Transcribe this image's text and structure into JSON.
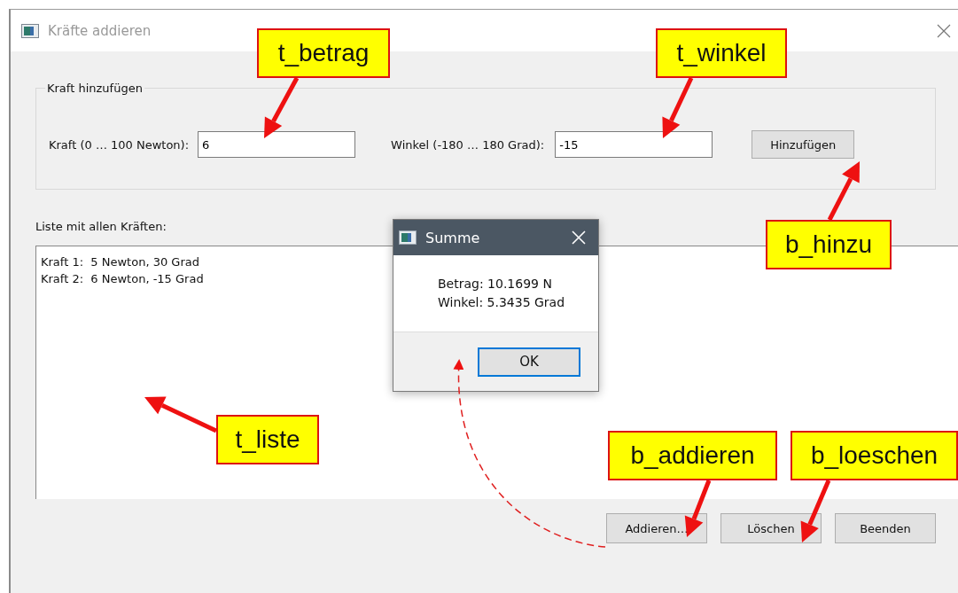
{
  "window": {
    "title": "Kräfte addieren"
  },
  "group": {
    "title": "Kraft hinzufügen",
    "force_label": "Kraft (0 … 100 Newton):",
    "force_value": "6",
    "angle_label": "Winkel (-180 … 180 Grad):",
    "angle_value": "-15",
    "add_button": "Hinzufügen"
  },
  "list": {
    "label": "Liste mit allen Kräften:",
    "items": [
      "Kraft 1:  5 Newton, 30 Grad",
      "Kraft 2:  6 Newton, -15 Grad"
    ]
  },
  "buttons": [
    "Addieren…",
    "Löschen",
    "Beenden"
  ],
  "dialog": {
    "title": "Summe",
    "lines": [
      "Betrag: 10.1699 N",
      "Winkel: 5.3435 Grad"
    ],
    "button": "OK"
  },
  "annotations": [
    {
      "label": "t_betrag"
    },
    {
      "label": "t_winkel"
    },
    {
      "label": "b_hinzu"
    },
    {
      "label": "t_liste"
    },
    {
      "label": "b_addieren"
    },
    {
      "label": "b_loeschen"
    }
  ]
}
